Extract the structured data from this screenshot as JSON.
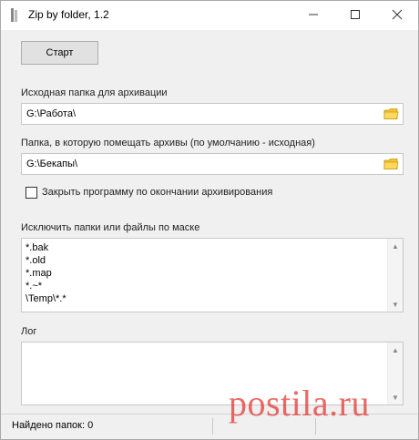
{
  "window": {
    "title": "Zip by folder, 1.2"
  },
  "toolbar": {
    "start_label": "Старт"
  },
  "source": {
    "label": "Исходная папка для архивации",
    "value": "G:\\Работа\\"
  },
  "target": {
    "label": "Папка, в которую помещать архивы (по умолчанию - исходная)",
    "value": "G:\\Бекапы\\"
  },
  "close_option": {
    "label": "Закрыть программу по окончании архивирования",
    "checked": false
  },
  "exclude": {
    "label": "Исключить папки или файлы по маске",
    "lines": [
      "*.bak",
      "*.old",
      "*.map",
      "*.~*",
      "\\Temp\\*.*"
    ]
  },
  "log": {
    "label": "Лог",
    "content": ""
  },
  "status": {
    "text": "Найдено папок: 0"
  },
  "watermark": {
    "text": "postila.ru"
  },
  "icons": {
    "folder": "folder-icon",
    "close": "close-icon",
    "maximize": "maximize-icon",
    "minimize": "minimize-icon"
  },
  "colors": {
    "folder": "#f4c430",
    "watermark": "#e53935"
  }
}
